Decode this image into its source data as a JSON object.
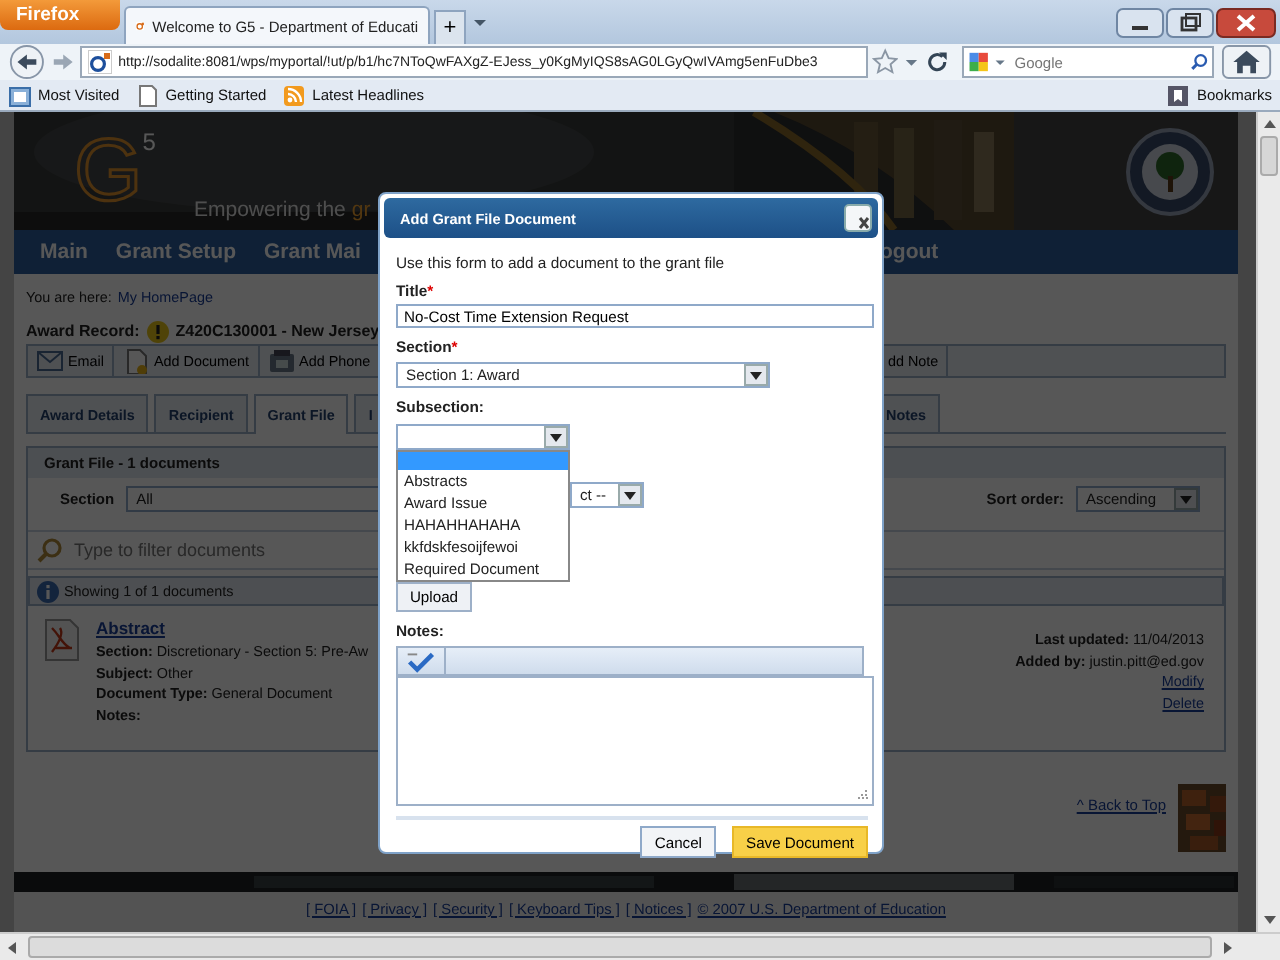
{
  "browser": {
    "menu_button": "Firefox",
    "tabs": [
      {
        "label": "Welcome to G5 - Department of Educati",
        "selected": true
      }
    ],
    "new_tab": "+",
    "url": "http://sodalite:8081/wps/myportal/!ut/p/b1/hc7NToQwFAXgZ-EJess_y0KgMyIQS8sAG0LGyQwIVAmg5enFuDbe3",
    "search_placeholder": "Google",
    "bookmarks": [
      "Most Visited",
      "Getting Started",
      "Latest Headlines"
    ],
    "bookmarks_menu": "Bookmarks"
  },
  "banner": {
    "logo": "G",
    "logo_sup": "5",
    "tagline": "Empowering the",
    "tagline_accent": "gr"
  },
  "nav": [
    "Main",
    "Grant Setup",
    "Grant Mai",
    "ogout"
  ],
  "breadcrumb": {
    "label": "You are here:",
    "link": "My HomePage"
  },
  "record": {
    "label": "Award Record:",
    "value": "Z420C130001 - New Jersey"
  },
  "toolbar": [
    {
      "label": "Email",
      "kind": "email"
    },
    {
      "label": "Add Document",
      "kind": "document"
    },
    {
      "label": "Add Phone",
      "kind": "phone"
    },
    {
      "label": "dd Note",
      "kind": "none"
    }
  ],
  "tabs": [
    {
      "label": "Award Details",
      "selected": false
    },
    {
      "label": "Recipient",
      "selected": false
    },
    {
      "label": "Grant File",
      "selected": true
    },
    {
      "label": "I",
      "selected": false
    },
    {
      "label": "Notes",
      "selected": false
    }
  ],
  "panel": {
    "title": "Grant File - 1 documents",
    "section_label": "Section",
    "section_value": "All",
    "sort_label": "Sort order:",
    "sort_value": "Ascending",
    "filter_placeholder": "Type to filter documents",
    "info": "Showing 1 of 1 documents",
    "documents": [
      {
        "title": "Abstract",
        "fields": [
          {
            "label": "Section:",
            "value": "Discretionary - Section 5: Pre-Aw"
          },
          {
            "label": "Subject:",
            "value": "Other"
          },
          {
            "label": "Document Type:",
            "value": "General Document"
          },
          {
            "label": "Notes:"
          }
        ],
        "last_updated_label": "Last updated:",
        "last_updated": "11/04/2013",
        "added_by_label": "Added by:",
        "added_by": "justin.pitt@ed.gov",
        "actions": [
          "Modify",
          "Delete"
        ]
      }
    ]
  },
  "back_to_top": "^ Back to Top",
  "footer": {
    "links": [
      "[ FOIA ]",
      "[ Privacy ]",
      "[ Security ]",
      "[ Keyboard Tips ]",
      "[ Notices ]"
    ],
    "copyright": "© 2007 U.S. Department of Education"
  },
  "modal": {
    "title": "Add Grant File Document",
    "intro": "Use this form to add a document to the grant file",
    "title_field": {
      "label": "Title",
      "required_mark": "*",
      "value": "No-Cost Time Extension Request"
    },
    "section_field": {
      "label": "Section",
      "required_mark": "*",
      "value": "Section 1: Award"
    },
    "subsection_field": {
      "label": "Subsection:",
      "expanded": true,
      "blank_highlighted": true,
      "options": [
        {
          "label": "Abstracts",
          "selected": false
        },
        {
          "label": "Award Issue",
          "selected": false
        },
        {
          "label": "HAHAHHAHAHA",
          "selected": false
        },
        {
          "label": "kkfdskfesoijfewoi",
          "selected": false
        },
        {
          "label": "Required Document",
          "selected": false
        }
      ]
    },
    "doc_type_value": "ct --",
    "upload": "Upload",
    "notes_label": "Notes:",
    "buttons": [
      {
        "label": "Cancel",
        "kind": "secondary"
      },
      {
        "label": "Save Document",
        "kind": "primary"
      }
    ]
  }
}
